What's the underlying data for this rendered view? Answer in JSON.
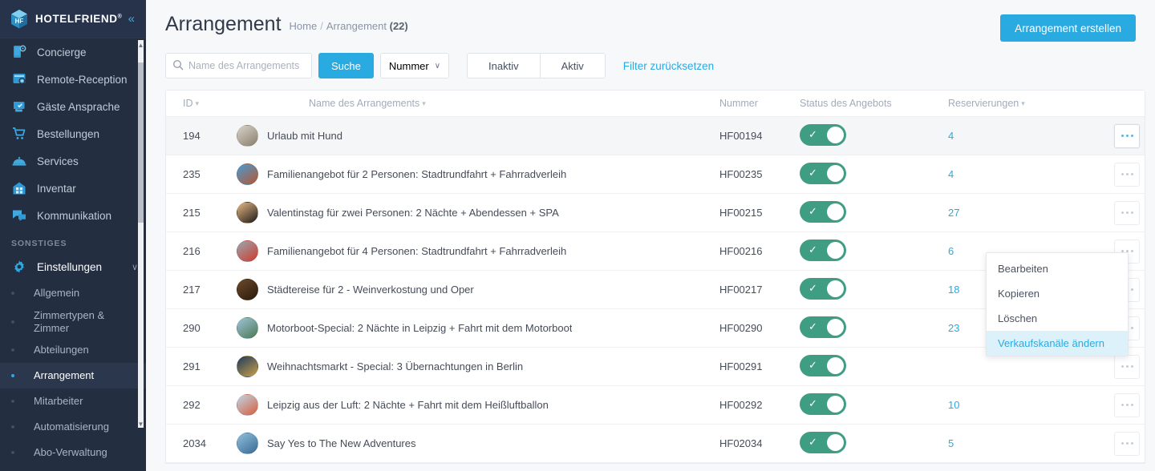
{
  "brand": {
    "name": "HOTELFRIEND",
    "registered": "®",
    "cube_letters": "HF",
    "collapse_icon": "«",
    "accent": "#29abe2",
    "sidebar_bg": "#232e41",
    "toggle_green": "#3f9d83"
  },
  "sidebar": {
    "items": [
      {
        "label": "Concierge",
        "icon": "concierge-icon"
      },
      {
        "label": "Remote-Reception",
        "icon": "remote-reception-icon"
      },
      {
        "label": "Gäste Ansprache",
        "icon": "guest-address-icon"
      },
      {
        "label": "Bestellungen",
        "icon": "orders-cart-icon"
      },
      {
        "label": "Services",
        "icon": "services-cloche-icon"
      },
      {
        "label": "Inventar",
        "icon": "inventory-building-icon"
      },
      {
        "label": "Kommunikation",
        "icon": "communication-chat-icon"
      }
    ],
    "section_label": "SONSTIGES",
    "settings": {
      "label": "Einstellungen",
      "icon": "gear-icon",
      "chevron": "∨"
    },
    "sub_items": [
      {
        "label": "Allgemein",
        "active": false
      },
      {
        "label": "Zimmertypen & Zimmer",
        "active": false
      },
      {
        "label": "Abteilungen",
        "active": false
      },
      {
        "label": "Arrangement",
        "active": true
      },
      {
        "label": "Mitarbeiter",
        "active": false
      },
      {
        "label": "Automatisierung",
        "active": false
      },
      {
        "label": "Abo-Verwaltung",
        "active": false
      }
    ]
  },
  "header": {
    "title": "Arrangement",
    "breadcrumb_home": "Home",
    "breadcrumb_sep": "/",
    "breadcrumb_current": "Arrangement",
    "breadcrumb_count": "(22)",
    "create_button": "Arrangement erstellen"
  },
  "filters": {
    "search_placeholder": "Name des Arrangements",
    "search_value": "",
    "search_button": "Suche",
    "select_label": "Nummer",
    "select_chevron": "∨",
    "inactive_button": "Inaktiv",
    "active_button": "Aktiv",
    "reset_link": "Filter zurücksetzen"
  },
  "table": {
    "columns": [
      {
        "key": "id",
        "label": "ID",
        "sortable": true
      },
      {
        "key": "name",
        "label": "Name des Arrangements",
        "sortable": true
      },
      {
        "key": "number",
        "label": "Nummer",
        "sortable": false
      },
      {
        "key": "status",
        "label": "Status des Angebots",
        "sortable": false
      },
      {
        "key": "reservations",
        "label": "Reservierungen",
        "sortable": true
      },
      {
        "key": "actions",
        "label": "",
        "sortable": false
      }
    ],
    "rows": [
      {
        "id": "194",
        "name": "Urlaub mit Hund",
        "number": "HF00194",
        "status_on": true,
        "reservations": "4",
        "avatar_colors": [
          "#d8d2c8",
          "#8a7f6e"
        ],
        "selected": true
      },
      {
        "id": "235",
        "name": "Familienangebot für 2 Personen: Stadtrundfahrt + Fahrradverleih",
        "number": "HF00235",
        "status_on": true,
        "reservations": "4",
        "avatar_colors": [
          "#4a9bd4",
          "#b5562f"
        ],
        "selected": false
      },
      {
        "id": "215",
        "name": "Valentinstag für zwei Personen: 2 Nächte + Abendessen + SPA",
        "number": "HF00215",
        "status_on": true,
        "reservations": "27",
        "avatar_colors": [
          "#e8b882",
          "#1b1b1b"
        ],
        "selected": false
      },
      {
        "id": "216",
        "name": "Familienangebot für 4 Personen: Stadtrundfahrt + Fahrradverleih",
        "number": "HF00216",
        "status_on": true,
        "reservations": "6",
        "avatar_colors": [
          "#9aa7ae",
          "#cf3b2e"
        ],
        "selected": false
      },
      {
        "id": "217",
        "name": "Städtereise für 2 - Weinverkostung und Oper",
        "number": "HF00217",
        "status_on": true,
        "reservations": "18",
        "avatar_colors": [
          "#6b4a2a",
          "#2a1a0e"
        ],
        "selected": false
      },
      {
        "id": "290",
        "name": "Motorboot-Special: 2 Nächte in Leipzig + Fahrt mit dem Motorboot",
        "number": "HF00290",
        "status_on": true,
        "reservations": "23",
        "avatar_colors": [
          "#9fc3d8",
          "#4a7a54"
        ],
        "selected": false
      },
      {
        "id": "291",
        "name": "Weihnachtsmarkt - Special: 3 Übernachtungen in Berlin",
        "number": "HF00291",
        "status_on": true,
        "reservations": "",
        "avatar_colors": [
          "#1e3a5c",
          "#c9a04a"
        ],
        "selected": false
      },
      {
        "id": "292",
        "name": "Leipzig aus der Luft: 2 Nächte + Fahrt mit dem Heißluftballon",
        "number": "HF00292",
        "status_on": true,
        "reservations": "10",
        "avatar_colors": [
          "#bcd6e8",
          "#d85f3a"
        ],
        "selected": false
      },
      {
        "id": "2034",
        "name": "Say Yes to The New Adventures",
        "number": "HF02034",
        "status_on": true,
        "reservations": "5",
        "avatar_colors": [
          "#8fc0dd",
          "#3a6a92"
        ],
        "selected": false
      }
    ]
  },
  "context_menu": {
    "items": [
      {
        "label": "Bearbeiten",
        "highlighted": false
      },
      {
        "label": "Kopieren",
        "highlighted": false
      },
      {
        "label": "Löschen",
        "highlighted": false
      },
      {
        "label": "Verkaufskanäle ändern",
        "highlighted": true
      }
    ]
  }
}
